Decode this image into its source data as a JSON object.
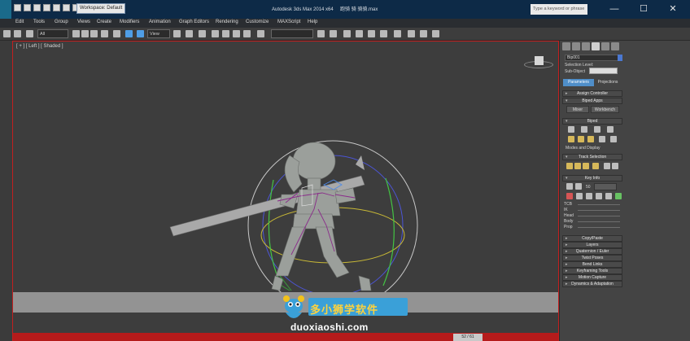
{
  "titlebar": {
    "workspace": "Workspace: Default",
    "app_title": "Autodesk 3ds Max 2014 x64         跑骑 骑 骑骑.max",
    "search_placeholder": "Type a keyword or phrase",
    "minimize": "—",
    "maximize": "☐",
    "close": "✕"
  },
  "menu": {
    "items": [
      "Edit",
      "Tools",
      "Group",
      "Views",
      "Create",
      "Modifiers",
      "Animation",
      "Graph Editors",
      "Rendering",
      "Customize",
      "MAXScript",
      "Help"
    ]
  },
  "toolbar": {
    "filter_value": "All",
    "refcoord_value": "View",
    "selection_set_value": ""
  },
  "viewport": {
    "label": "[ + ] [ Left ] [ Shaded ]",
    "frame_counter": "52 / 61"
  },
  "watermark": {
    "text": "duoxiaoshi.com",
    "label": "多小狮学软件"
  },
  "panel": {
    "object_name": "Bip001",
    "selection_level_label": "Selection Level:",
    "sub_object_label": "Sub-Object",
    "tab_parameters": "Parameters",
    "tab_projections": "Projections",
    "rollouts": {
      "assign_controller": "Assign Controller",
      "biped_apps": "Biped Apps",
      "mixer": "Mixer",
      "workbench": "Workbench",
      "biped": "Biped",
      "modes_display": "Modes and Display",
      "track_selection": "Track Selection",
      "key_info": "Key Info",
      "key_field": "50",
      "copy_paste": "Copy/Paste",
      "layers": "Layers",
      "quaternion_euler": "Quaternion / Euler",
      "twist_poses": "Twist Poses",
      "bend_links": "Bend Links",
      "keyframing_tools": "Keyframing Tools",
      "motion_capture": "Motion Capture",
      "dynamics_adaptation": "Dynamics & Adaptation"
    },
    "tcb": [
      "TCB",
      "IK",
      "Head",
      "Body",
      "Prop"
    ]
  },
  "colors": {
    "title_bg": "#0d2a47",
    "accent_blue": "#4f8ec9",
    "viewport_border": "#c21f1f",
    "status_red": "#b51b1b"
  }
}
